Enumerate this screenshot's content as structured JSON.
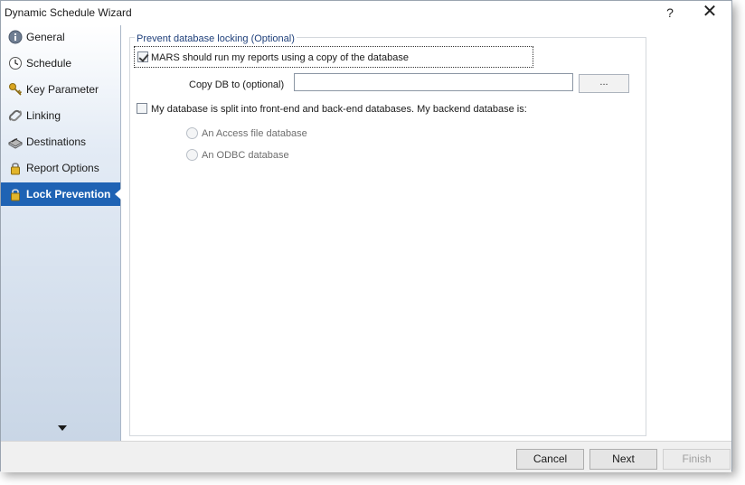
{
  "window": {
    "title": "Dynamic Schedule Wizard",
    "help_glyph": "?",
    "close_glyph": "✕"
  },
  "sidebar": {
    "items": [
      {
        "label": "General",
        "icon": "info-icon"
      },
      {
        "label": "Schedule",
        "icon": "clock-icon"
      },
      {
        "label": "Key Parameter",
        "icon": "key-icon"
      },
      {
        "label": "Linking",
        "icon": "link-icon"
      },
      {
        "label": "Destinations",
        "icon": "destinations-icon"
      },
      {
        "label": "Report Options",
        "icon": "lock-icon"
      },
      {
        "label": "Lock Prevention",
        "icon": "lock-icon",
        "active": true
      }
    ]
  },
  "content": {
    "group_title": "Prevent database locking (Optional)",
    "mars_copy_checkbox": {
      "label": "MARS should run my reports using a copy of the database",
      "checked": true
    },
    "copy_db_label": "Copy DB to (optional)",
    "copy_db_value": "",
    "browse_label": "...",
    "split_db_checkbox": {
      "label": "My database is split into front-end and back-end databases. My backend database is:",
      "checked": false
    },
    "radio_access": {
      "label": "An Access file database"
    },
    "radio_odbc": {
      "label": "An ODBC database"
    }
  },
  "footer": {
    "cancel_label": "Cancel",
    "next_label": "Next",
    "finish_label": "Finish"
  },
  "colors": {
    "active_nav": "#1f63b4",
    "group_title": "#1e3f7a"
  }
}
